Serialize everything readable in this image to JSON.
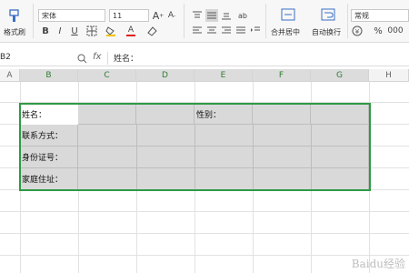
{
  "toolbar": {
    "format_painter": "格式刷",
    "font_name": "宋体",
    "font_size": "11",
    "bold": "B",
    "italic": "I",
    "underline": "U",
    "merge_center": "合并居中",
    "wrap_text": "自动换行",
    "number_format": "常规",
    "percent": "%"
  },
  "formula": {
    "cell_ref": "B2",
    "fx": "fx",
    "content": "姓名："
  },
  "columns": [
    "A",
    "B",
    "C",
    "D",
    "E",
    "F",
    "G",
    "H"
  ],
  "cells": {
    "name": "姓名：",
    "gender": "性别：",
    "contact": "联系方式：",
    "id_number": "身份证号：",
    "address": "家庭住址："
  },
  "watermark": "Baidu经验"
}
